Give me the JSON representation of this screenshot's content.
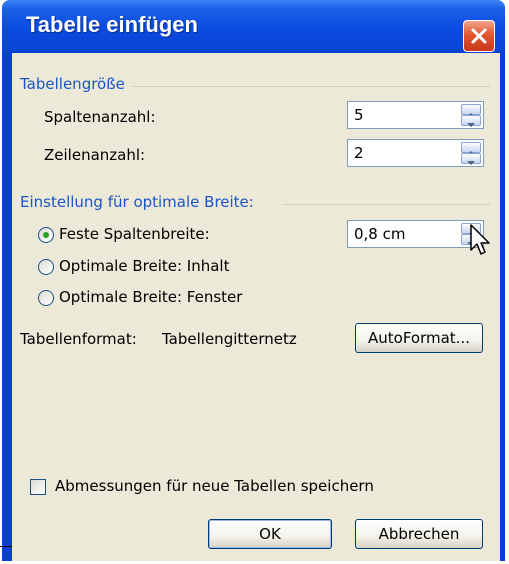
{
  "window": {
    "title": "Tabelle einfügen"
  },
  "size_group": {
    "label": "Tabellengröße",
    "columns_label": "Spaltenanzahl:",
    "columns_value": "5",
    "rows_label": "Zeilenanzahl:",
    "rows_value": "2"
  },
  "autofit_group": {
    "label": "Einstellung für optimale Breite:",
    "options": [
      {
        "label": "Feste Spaltenbreite:",
        "checked": true
      },
      {
        "label": "Optimale Breite: Inhalt",
        "checked": false
      },
      {
        "label": "Optimale Breite: Fenster",
        "checked": false
      }
    ],
    "fixed_width_value": "0,8 cm"
  },
  "table_format": {
    "label": "Tabellenformat:",
    "value": "Tabellengitternetz",
    "autoformat_button": "AutoFormat..."
  },
  "remember_checkbox": {
    "label": "Abmessungen für neue Tabellen speichern",
    "checked": false
  },
  "buttons": {
    "ok": "OK",
    "cancel": "Abbrechen"
  },
  "colors": {
    "title_bar": "#0a44d2",
    "client_bg": "#ece9d8",
    "group_label": "#1a56c6",
    "close_button": "#e2572f"
  },
  "icons": {
    "close": "close-x-icon",
    "spinner": "spin-arrows-icon",
    "cursor": "mouse-pointer-icon"
  }
}
